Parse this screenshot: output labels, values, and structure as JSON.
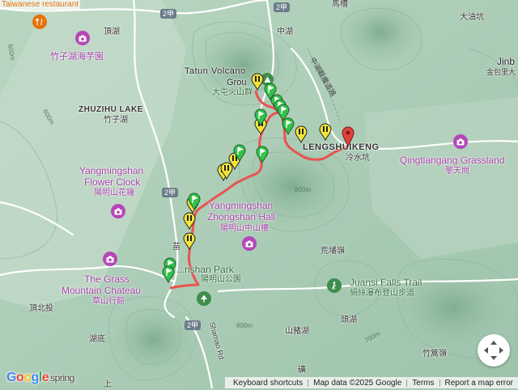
{
  "labels": {
    "taiwanese_restaurant": "Taiwanese restaurant",
    "dingtou": "頂湖",
    "zhuzihu_taro": "竹子湖海芋園",
    "tatun_en_1": "Tatun Volcano",
    "tatun_en_2": "Grou",
    "tatun_zh": "大屯火山群",
    "zhuzihu_lake_en": "ZHUZIHU LAKE",
    "zhuzihu_lake_zh": "竹子湖",
    "flower_clock_en_1": "Yangmingshan",
    "flower_clock_en_2": "Flower Clock",
    "flower_clock_zh": "陽明山花鐘",
    "zhongshan_en_1": "Yangmingshan",
    "zhongshan_en_2": "Zhongshan Hall",
    "zhongshan_zh": "陽明山中山樓",
    "lengshuikeng_en": "LENGSHUIKENG",
    "lengshuikeng_zh": "冷水坑",
    "qingtiangang_en": "Qingtiangang Grassland",
    "qingtiangang_zh": "擎天崗",
    "grass_chateau_en_1": "The Grass",
    "grass_chateau_en_2": "Mountain Chateau",
    "grass_chateau_zh": "草山行館",
    "park_en": "...nshan Park",
    "park_zh": "陽明山公園",
    "juansi_en": "Juansi Falls Trail",
    "juansi_zh": "絹絲瀑布登山步道",
    "zhonghu": "中湖",
    "datun_pit": "大油坑",
    "jinb_1": "Jinb",
    "jinb_2": "金包里大",
    "huangpu": "荒埔嶺",
    "toulin": "頭湖",
    "shanzhu": "山豬湖",
    "dingbeitou": "頂北投",
    "hudi": "湖底",
    "zhuanling": "竹篙嶺",
    "miao": "苗",
    "zhuzihu_n": "竹子",
    "shamao_rd": "Shamao Rd",
    "jie": "礦",
    "shang": "上",
    "maching": "馬槽",
    "road_2a": "2甲",
    "road_2a_b": "2甲",
    "road_2a_c": "2甲",
    "road_2a_d": "2甲",
    "c600": "600m",
    "c600b": "600m",
    "c800": "800m",
    "c800b": "800m",
    "c700": "700m",
    "ridge_road_zh": "中湖戰備道路"
  },
  "footer": {
    "keyboard": "Keyboard shortcuts",
    "mapdata": "Map data ©2025 Google",
    "terms": "Terms",
    "report": "Report a map error"
  },
  "logo": {
    "text": "Google",
    "suffix": "spring"
  },
  "colors": {
    "route": "#e8534f",
    "marker_yellow": "#f2e43a",
    "marker_green": "#33c24a",
    "end_pin": "#e0403c",
    "start_pin": "#33c24a"
  }
}
